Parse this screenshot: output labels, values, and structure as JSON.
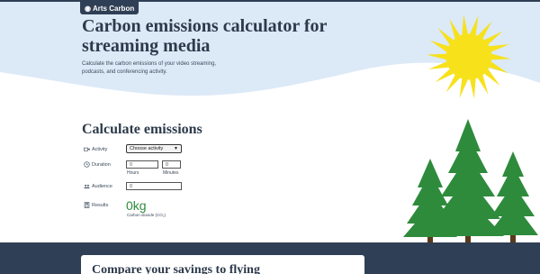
{
  "brand": {
    "logo_text": "Arts Carbon"
  },
  "hero": {
    "title": "Carbon emissions calculator for streaming media",
    "subtitle": "Calculate the carbon emissions of your video streaming, podcasts, and conferencing activity."
  },
  "calculator": {
    "heading": "Calculate emissions",
    "activity": {
      "label": "Activity",
      "selected": "Choose activity"
    },
    "duration": {
      "label": "Duration",
      "hours_value": "0",
      "minutes_value": "0",
      "hours_label": "Hours",
      "minutes_label": "Minutes"
    },
    "audience": {
      "label": "Audience",
      "value": "0"
    },
    "results": {
      "label": "Results",
      "value": "0kg",
      "unit": "Carbon dioxide (CO₂)"
    }
  },
  "compare": {
    "heading": "Compare your savings to flying"
  },
  "colors": {
    "navy": "#2f3f55",
    "sky": "#dce9f7",
    "sun": "#f7e11b",
    "tree": "#2e8b3c"
  },
  "icons": {
    "activity": "video-camera-icon",
    "duration": "clock-icon",
    "audience": "audience-icon",
    "results": "calculator-icon"
  }
}
